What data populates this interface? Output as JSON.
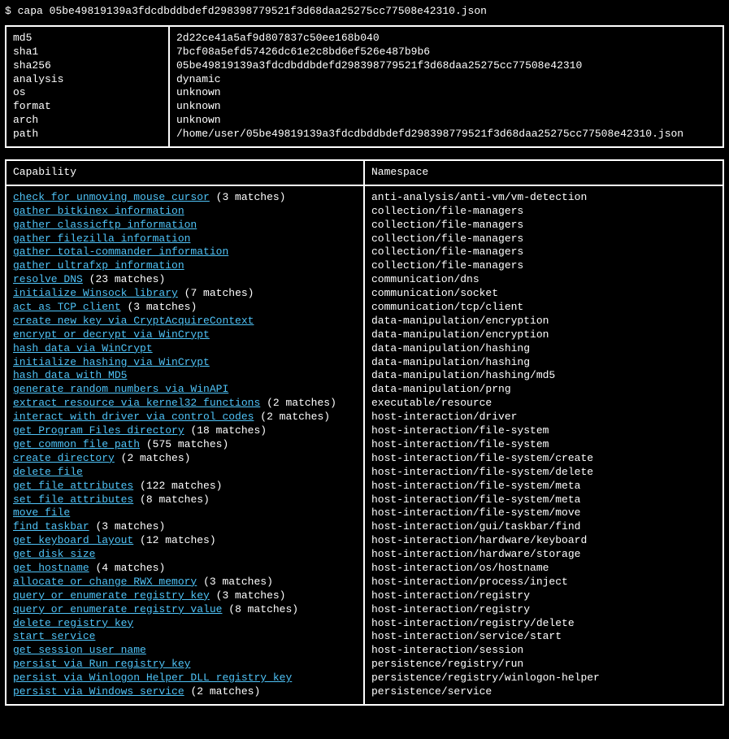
{
  "command": {
    "prompt": "$",
    "tool": "capa",
    "arg": "05be49819139a3fdcdbddbdefd298398779521f3d68daa25275cc77508e42310.json"
  },
  "metadata": [
    {
      "key": "md5",
      "value": "2d22ce41a5af9d807837c50ee168b040"
    },
    {
      "key": "sha1",
      "value": "7bcf08a5efd57426dc61e2c8bd6ef526e487b9b6"
    },
    {
      "key": "sha256",
      "value": "05be49819139a3fdcdbddbdefd298398779521f3d68daa25275cc77508e42310"
    },
    {
      "key": "analysis",
      "value": "dynamic"
    },
    {
      "key": "os",
      "value": "unknown"
    },
    {
      "key": "format",
      "value": "unknown"
    },
    {
      "key": "arch",
      "value": "unknown"
    },
    {
      "key": "path",
      "value": "/home/user/05be49819139a3fdcdbddbdefd298398779521f3d68daa25275cc77508e42310.json"
    }
  ],
  "cap_headers": {
    "capability": "Capability",
    "namespace": "Namespace"
  },
  "capabilities": [
    {
      "name": "check for unmoving mouse cursor",
      "matches": "(3 matches)",
      "namespace": "anti-analysis/anti-vm/vm-detection"
    },
    {
      "name": "gather bitkinex information",
      "matches": "",
      "namespace": "collection/file-managers"
    },
    {
      "name": "gather classicftp information",
      "matches": "",
      "namespace": "collection/file-managers"
    },
    {
      "name": "gather filezilla information",
      "matches": "",
      "namespace": "collection/file-managers"
    },
    {
      "name": "gather total-commander information",
      "matches": "",
      "namespace": "collection/file-managers"
    },
    {
      "name": "gather ultrafxp information",
      "matches": "",
      "namespace": "collection/file-managers"
    },
    {
      "name": "resolve DNS",
      "matches": "(23 matches)",
      "namespace": "communication/dns"
    },
    {
      "name": "initialize Winsock library",
      "matches": "(7 matches)",
      "namespace": "communication/socket"
    },
    {
      "name": "act as TCP client",
      "matches": "(3 matches)",
      "namespace": "communication/tcp/client"
    },
    {
      "name": "create new key via CryptAcquireContext",
      "matches": "",
      "namespace": "data-manipulation/encryption"
    },
    {
      "name": "encrypt or decrypt via WinCrypt",
      "matches": "",
      "namespace": "data-manipulation/encryption"
    },
    {
      "name": "hash data via WinCrypt",
      "matches": "",
      "namespace": "data-manipulation/hashing"
    },
    {
      "name": "initialize hashing via WinCrypt",
      "matches": "",
      "namespace": "data-manipulation/hashing"
    },
    {
      "name": "hash data with MD5",
      "matches": "",
      "namespace": "data-manipulation/hashing/md5"
    },
    {
      "name": "generate random numbers via WinAPI",
      "matches": "",
      "namespace": "data-manipulation/prng"
    },
    {
      "name": "extract resource via kernel32 functions",
      "matches": "(2 matches)",
      "namespace": "executable/resource"
    },
    {
      "name": "interact with driver via control codes",
      "matches": "(2 matches)",
      "namespace": "host-interaction/driver"
    },
    {
      "name": "get Program Files directory",
      "matches": "(18 matches)",
      "namespace": "host-interaction/file-system"
    },
    {
      "name": "get common file path",
      "matches": "(575 matches)",
      "namespace": "host-interaction/file-system"
    },
    {
      "name": "create directory",
      "matches": "(2 matches)",
      "namespace": "host-interaction/file-system/create"
    },
    {
      "name": "delete file",
      "matches": "",
      "namespace": "host-interaction/file-system/delete"
    },
    {
      "name": "get file attributes",
      "matches": "(122 matches)",
      "namespace": "host-interaction/file-system/meta"
    },
    {
      "name": "set file attributes",
      "matches": "(8 matches)",
      "namespace": "host-interaction/file-system/meta"
    },
    {
      "name": "move file",
      "matches": "",
      "namespace": "host-interaction/file-system/move"
    },
    {
      "name": "find taskbar",
      "matches": "(3 matches)",
      "namespace": "host-interaction/gui/taskbar/find"
    },
    {
      "name": "get keyboard layout",
      "matches": "(12 matches)",
      "namespace": "host-interaction/hardware/keyboard"
    },
    {
      "name": "get disk size",
      "matches": "",
      "namespace": "host-interaction/hardware/storage"
    },
    {
      "name": "get hostname",
      "matches": "(4 matches)",
      "namespace": "host-interaction/os/hostname"
    },
    {
      "name": "allocate or change RWX memory",
      "matches": "(3 matches)",
      "namespace": "host-interaction/process/inject"
    },
    {
      "name": "query or enumerate registry key",
      "matches": "(3 matches)",
      "namespace": "host-interaction/registry"
    },
    {
      "name": "query or enumerate registry value",
      "matches": "(8 matches)",
      "namespace": "host-interaction/registry"
    },
    {
      "name": "delete registry key",
      "matches": "",
      "namespace": "host-interaction/registry/delete"
    },
    {
      "name": "start service",
      "matches": "",
      "namespace": "host-interaction/service/start"
    },
    {
      "name": "get session user name",
      "matches": "",
      "namespace": "host-interaction/session"
    },
    {
      "name": "persist via Run registry key",
      "matches": "",
      "namespace": "persistence/registry/run"
    },
    {
      "name": "persist via Winlogon Helper DLL registry key",
      "matches": "",
      "namespace": "persistence/registry/winlogon-helper"
    },
    {
      "name": "persist via Windows service",
      "matches": "(2 matches)",
      "namespace": "persistence/service"
    }
  ]
}
